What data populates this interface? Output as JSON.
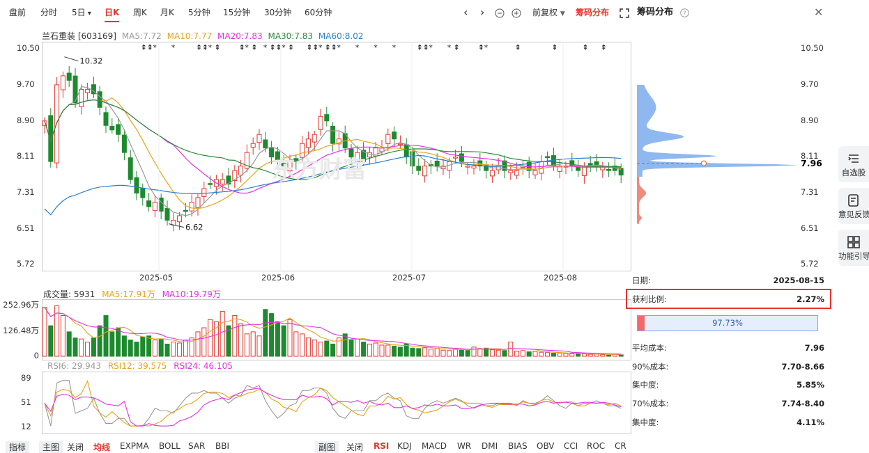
{
  "toolbar": {
    "tabs": [
      "盘前",
      "分时",
      "5日",
      "日K",
      "周K",
      "月K",
      "5分钟",
      "15分钟",
      "30分钟",
      "60分钟"
    ],
    "active_tab": "日K",
    "fuquan": "前复权",
    "chip_tab": "筹码分布",
    "panel_title": "筹码分布"
  },
  "stock": {
    "name_code": "兰石重装 [603169]"
  },
  "ma": {
    "ma5": "MA5:7.72",
    "ma10": "MA10:7.77",
    "ma20": "MA20:7.83",
    "ma30": "MA30:7.83",
    "ma60": "MA60:8.02"
  },
  "colors": {
    "up": "#e5342c",
    "down": "#1d8a2e",
    "ma5": "#999999",
    "ma10": "#e8a317",
    "ma20": "#e62ee6",
    "ma30": "#2b8a3e",
    "ma60": "#2a7fd0"
  },
  "price_axis": [
    "10.50",
    "9.70",
    "8.90",
    "8.11",
    "7.31",
    "6.51",
    "5.72"
  ],
  "price_axis_right": [
    "10.50",
    "9.70",
    "8.90",
    "8.11",
    "7.96",
    "7.31",
    "6.51",
    "5.72"
  ],
  "dates": [
    "2025-05",
    "2025-06",
    "2025-07",
    "2025-08"
  ],
  "annotations": {
    "high": "10.32",
    "low": "6.62"
  },
  "volume": {
    "label": "成交量: 5931",
    "ma5": "MA5:17.91万",
    "ma10": "MA10:19.79万",
    "axis": [
      "252.96万",
      "126.48万",
      "0"
    ]
  },
  "rsi": {
    "rsi6": "RSI6: 29.943",
    "rsi12": "RSI12: 39.575",
    "rsi24": "RSI24: 46.105",
    "axis": [
      "89",
      "51",
      "12"
    ]
  },
  "chip": {
    "date_label": "日期:",
    "date": "2025-08-15",
    "profit_label": "获利比例:",
    "profit": "2.27%",
    "bar_text": "97.73%",
    "profit_fraction": 0.0227,
    "avg_label": "平均成本:",
    "avg": "7.96",
    "c90_label": "90%成本:",
    "c90": "7.70-8.66",
    "conc90_label": "集中度:",
    "conc90": "5.85%",
    "c70_label": "70%成本:",
    "c70": "7.74-8.40",
    "conc70_label": "集中度:",
    "conc70": "4.11%"
  },
  "sidebar": [
    "自选股",
    "意见反馈",
    "功能引导"
  ],
  "bottom": {
    "left": [
      "指标",
      "主图",
      "关闭",
      "均线",
      "EXPMA",
      "BOLL",
      "SAR",
      "BBI"
    ],
    "right": [
      "副图",
      "关闭",
      "RSI",
      "KDJ",
      "MACD",
      "WR",
      "DMI",
      "BIAS",
      "OBV",
      "CCI",
      "ROC",
      "CR"
    ],
    "left_active": "均线",
    "right_active": "RSI"
  },
  "watermark": "东方财富"
}
